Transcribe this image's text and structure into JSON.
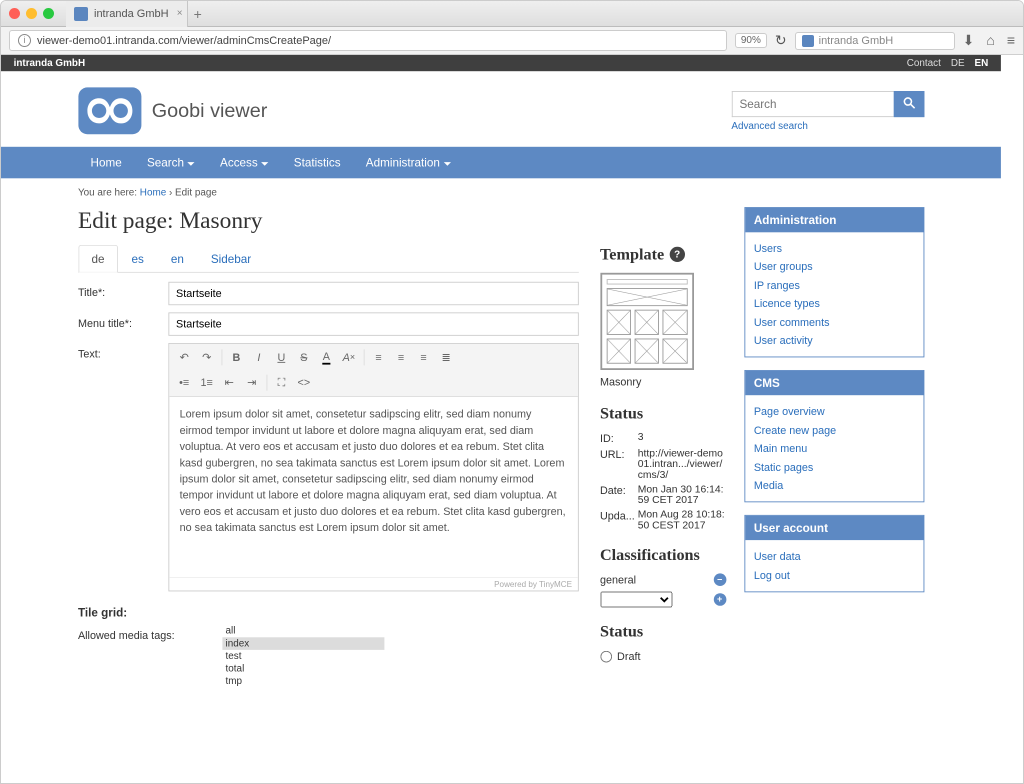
{
  "browser": {
    "tab_title": "intranda GmbH",
    "url": "viewer-demo01.intranda.com/viewer/adminCmsCreatePage/",
    "zoom": "90%",
    "right_search_placeholder": "intranda GmbH"
  },
  "topbar": {
    "brand": "intranda GmbH",
    "contact": "Contact",
    "lang1": "DE",
    "lang2": "EN"
  },
  "logo_text": "Goobi viewer",
  "search": {
    "placeholder": "Search",
    "advanced": "Advanced search"
  },
  "nav": {
    "home": "Home",
    "search": "Search",
    "access": "Access",
    "statistics": "Statistics",
    "admin": "Administration"
  },
  "breadcrumb": {
    "prefix": "You are here:",
    "home": "Home",
    "sep": "›",
    "current": "Edit page"
  },
  "page_title": "Edit page: Masonry",
  "tabs": {
    "de": "de",
    "es": "es",
    "en": "en",
    "sidebar": "Sidebar"
  },
  "form": {
    "title_label": "Title*:",
    "title_value": "Startseite",
    "menu_label": "Menu title*:",
    "menu_value": "Startseite",
    "text_label": "Text:",
    "text_body": "Lorem ipsum dolor sit amet, consetetur sadipscing elitr, sed diam nonumy eirmod tempor invidunt ut labore et dolore magna aliquyam erat, sed diam voluptua. At vero eos et accusam et justo duo dolores et ea rebum. Stet clita kasd gubergren, no sea takimata sanctus est Lorem ipsum dolor sit amet. Lorem ipsum dolor sit amet, consetetur sadipscing elitr, sed diam nonumy eirmod tempor invidunt ut labore et dolore magna aliquyam erat, sed diam voluptua. At vero eos et accusam et justo duo dolores et ea rebum. Stet clita kasd gubergren, no sea takimata sanctus est Lorem ipsum dolor sit amet.",
    "editor_footer": "Powered by TinyMCE",
    "tile_grid": "Tile grid:",
    "allowed_tags": "Allowed media tags:",
    "media_tags": [
      "all",
      "index",
      "test",
      "total",
      "tmp"
    ]
  },
  "template": {
    "heading": "Template",
    "name": "Masonry"
  },
  "status": {
    "heading": "Status",
    "id_k": "ID:",
    "id_v": "3",
    "url_k": "URL:",
    "url_v": "http://viewer-demo01.intran.../viewer/cms/3/",
    "date_k": "Date:",
    "date_v": "Mon Jan 30 16:14:59 CET 2017",
    "upd_k": "Upda...",
    "upd_v": "Mon Aug 28 10:18:50 CEST 2017"
  },
  "classifications": {
    "heading": "Classifications",
    "item": "general"
  },
  "status2": {
    "heading": "Status",
    "draft": "Draft"
  },
  "panels": {
    "admin": {
      "title": "Administration",
      "links": [
        "Users",
        "User groups",
        "IP ranges",
        "Licence types",
        "User comments",
        "User activity"
      ]
    },
    "cms": {
      "title": "CMS",
      "links": [
        "Page overview",
        "Create new page",
        "Main menu",
        "Static pages",
        "Media"
      ]
    },
    "account": {
      "title": "User account",
      "links": [
        "User data",
        "Log out"
      ]
    }
  }
}
